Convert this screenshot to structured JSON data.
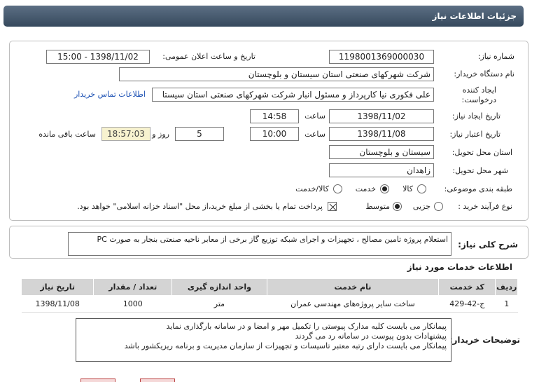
{
  "header": {
    "title": "جزئیات اطلاعات نیاز"
  },
  "form": {
    "need_number_label": "شماره نیاز:",
    "need_number": "1198001369000030",
    "announce_label": "تاریخ و ساعت اعلان عمومی:",
    "announce_value": "1398/11/02 - 15:00",
    "buyer_label": "نام دستگاه خریدار:",
    "buyer_value": "شرکت شهرکهای صنعتی استان سیستان و بلوچستان",
    "creator_label_1": "ایجاد کننده",
    "creator_label_2": "درخواست:",
    "creator_value": "علی  فکوری نیا کارپرداز و مسئول انبار شرکت شهرکهای صنعتی استان سیستا",
    "contact_link": "اطلاعات تماس خریدار",
    "created_date_label": "تاریخ ایجاد نیاز:",
    "created_date": "1398/11/02",
    "time_label": "ساعت",
    "created_time": "14:58",
    "validity_label": "تاریخ اعتبار نیاز:",
    "validity_date": "1398/11/08",
    "validity_time": "10:00",
    "days_value": "5",
    "day_label": "روز و",
    "remaining_time": "18:57:03",
    "remaining_label": "ساعت باقی مانده",
    "province_label": "استان محل تحویل:",
    "province_value": "سیستان و بلوچستان",
    "city_label": "شهر محل تحویل:",
    "city_value": "زاهدان",
    "category_label": "طبقه بندی موضوعی:",
    "category_options": [
      "کالا",
      "خدمت",
      "کالا/خدمت"
    ],
    "category_selected": "خدمت",
    "process_label": "نوع فرآیند خرید :",
    "process_options": [
      "جزیی",
      "متوسط"
    ],
    "process_selected": "متوسط",
    "payment_note": "پرداخت تمام یا بخشی از مبلغ خرید،از محل \"اسناد خزانه اسلامی\" خواهد بود.",
    "payment_checked": true
  },
  "description": {
    "label": "شرح کلی نیاز:",
    "text": "استعلام پروژه تامین مصالح ، تجهیزات و اجرای شبکه توزیع گاز برخی از معابر ناحیه صنعتی بنجار به صورت PC"
  },
  "services": {
    "section_title": "اطلاعات خدمات مورد نیاز",
    "columns": [
      "ردیف",
      "کد خدمت",
      "نام خدمت",
      "واحد اندازه گیری",
      "تعداد / مقدار",
      "تاریخ نیاز"
    ],
    "rows": [
      [
        "1",
        "ج-42-429",
        "ساخت سایر پروژه‌های مهندسی عمران",
        "متر",
        "1000",
        "1398/11/08"
      ]
    ]
  },
  "notes": {
    "label": "توضیحات خریدار:",
    "lines": [
      "پیمانکار می بایست کلیه مدارک پیوستی را تکمیل  مهر و امضا و در سامانه بارگذاری نماید",
      "پیشنهادات بدون پیوست در سامانه رد می گردند",
      "پیمانکار می بایست دارای رتبه معتبر تاسیسات و تجهیزات از سازمان مدیریت و برنامه ریزیکشور باشد"
    ]
  },
  "colors": {
    "header_bg": "#36495d",
    "link": "#1a4fb3",
    "remaining_bg": "#f7f2cf",
    "table_header_bg": "#d4d4d4"
  }
}
